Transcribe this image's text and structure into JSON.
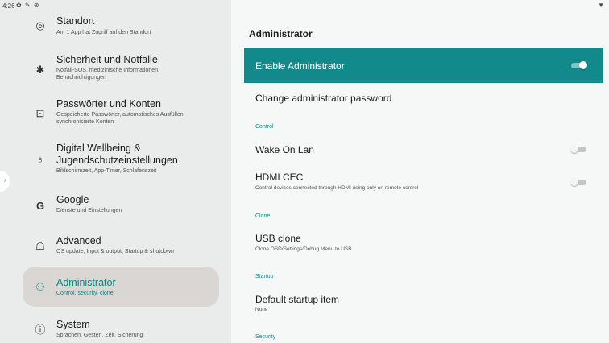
{
  "statusbar": {
    "time": "4:26",
    "icons": "✿ ✎ ⊛",
    "wifi_icon": "▼"
  },
  "sidebar": {
    "items": [
      {
        "icon": "◎",
        "icon_name": "location-pin-icon",
        "title": "Standort",
        "subtitle": "An: 1 App hat Zugriff auf den Standort"
      },
      {
        "icon": "✱",
        "icon_name": "asterisk-icon",
        "title": "Sicherheit und Notfälle",
        "subtitle": "Notfall-SOS, medizinische Informationen, Benachrichtigungen"
      },
      {
        "icon": "⊡",
        "icon_name": "password-icon",
        "title": "Passwörter und Konten",
        "subtitle": "Gespeicherte Passwörter, automatisches Ausfüllen, synchronisierte Konten"
      },
      {
        "icon": "♁",
        "icon_name": "wellbeing-icon",
        "title": "Digital Wellbeing & Jugendschutzeinstellungen",
        "subtitle": "Bildschirmzeit, App-Timer, Schlafenszeit"
      },
      {
        "icon": "G",
        "icon_name": "google-icon",
        "title": "Google",
        "subtitle": "Dienste und Einstellungen"
      },
      {
        "icon": "☖",
        "icon_name": "home-icon",
        "title": "Advanced",
        "subtitle": "OS update, Input & output, Startup & shutdown"
      },
      {
        "icon": "⚇",
        "icon_name": "admin-icon",
        "title": "Administrator",
        "subtitle": "Control, security, clone"
      },
      {
        "icon": "ⓘ",
        "icon_name": "info-icon",
        "title": "System",
        "subtitle": "Sprachen, Gesten, Zeit, Sicherung"
      }
    ],
    "handle_icon": "›"
  },
  "main": {
    "title": "Administrator",
    "enable_label": "Enable Administrator",
    "enable_on": true,
    "change_password": "Change administrator password",
    "cat_control": "Control",
    "wake_on_lan": "Wake On Lan",
    "hdmi_cec": "HDMI CEC",
    "hdmi_cec_sub": "Control devices connected through HDMI using only on remote control",
    "cat_clone": "Clone",
    "usb_clone": "USB clone",
    "usb_clone_sub": "Clone OSD/Settings/Debug Menu to USB",
    "cat_startup": "Startup",
    "default_startup": "Default startup item",
    "default_startup_sub": "None",
    "cat_security": "Security"
  },
  "colors": {
    "accent": "#12898a",
    "selected_bg": "#d9d6d3",
    "sidebar_bg": "#e9eceb",
    "content_bg": "#f6f8f8"
  }
}
